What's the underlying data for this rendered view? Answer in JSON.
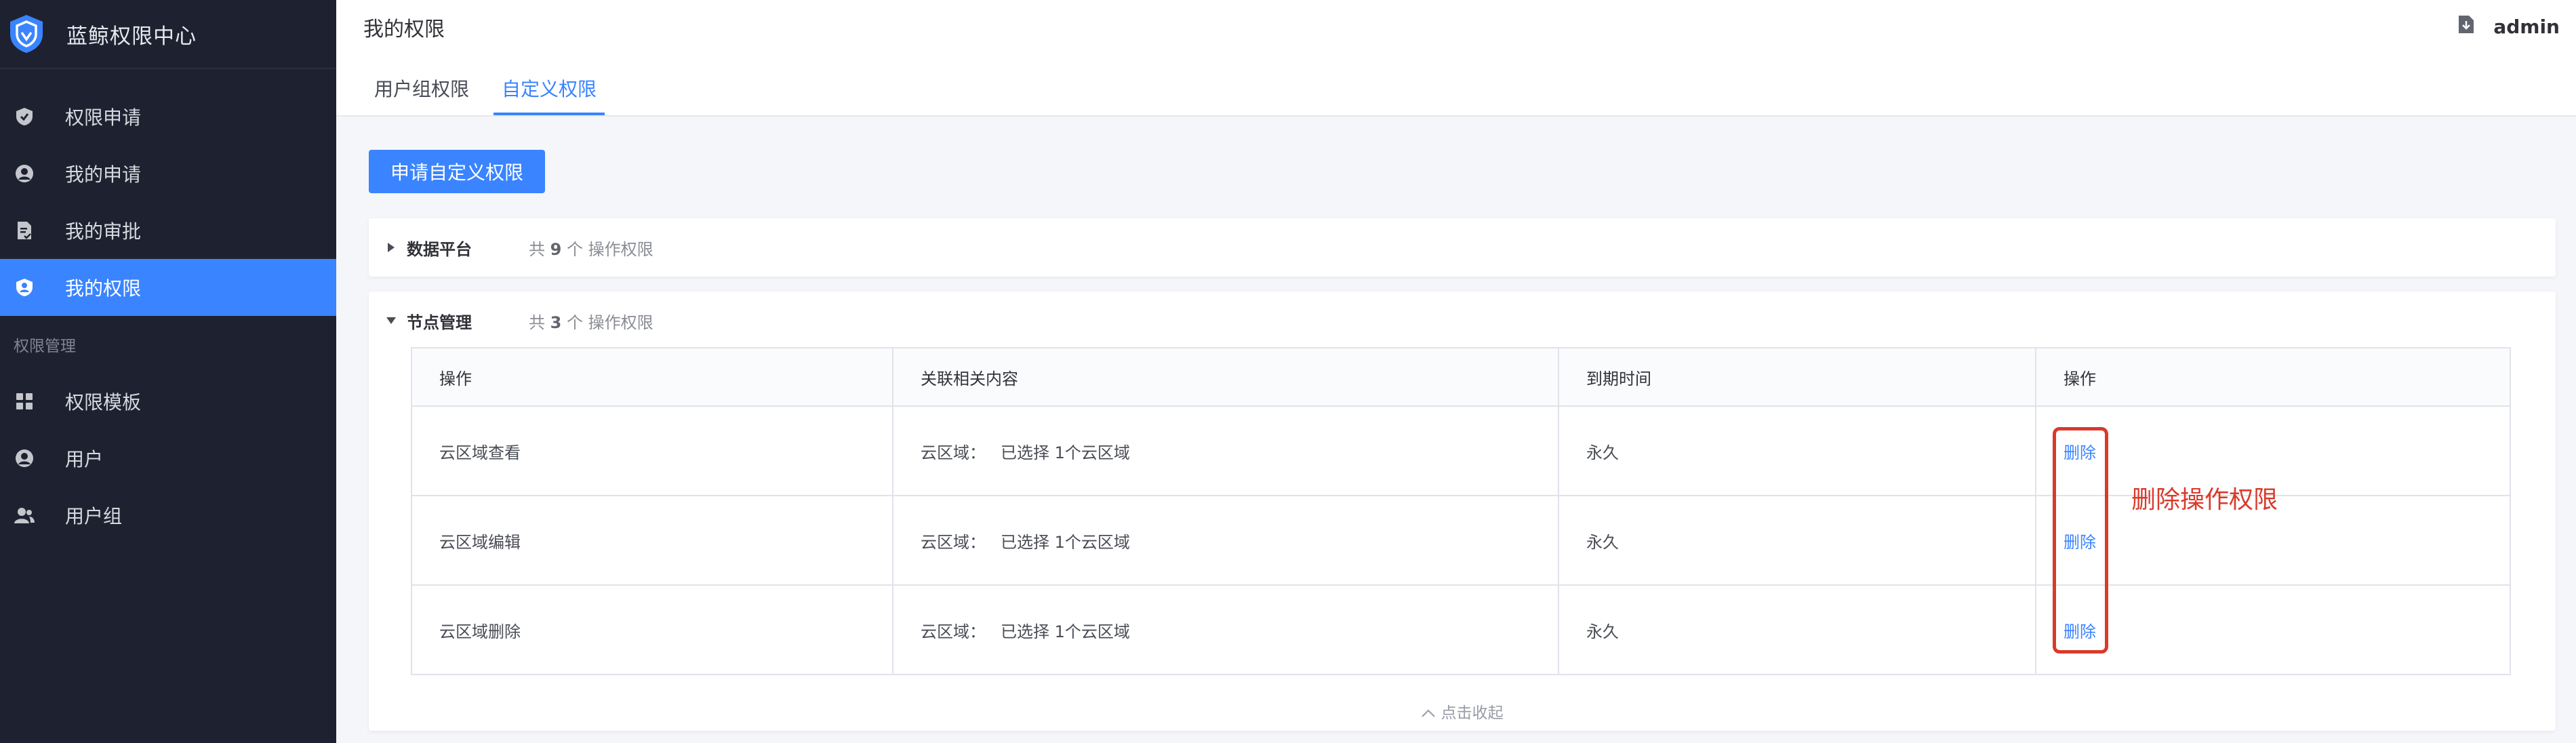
{
  "app": {
    "title": "蓝鲸权限中心",
    "brand_color": "#3a84ff",
    "logo_icon": "shield-logo-icon"
  },
  "sidebar": {
    "items": [
      {
        "label": "权限申请",
        "icon": "shield-check-icon",
        "active": false
      },
      {
        "label": "我的申请",
        "icon": "user-circle-icon",
        "active": false
      },
      {
        "label": "我的审批",
        "icon": "document-check-icon",
        "active": false
      },
      {
        "label": "我的权限",
        "icon": "shield-user-icon",
        "active": true
      }
    ],
    "group_title": "权限管理",
    "group_items": [
      {
        "label": "权限模板",
        "icon": "grid-icon"
      },
      {
        "label": "用户",
        "icon": "user-circle-icon"
      },
      {
        "label": "用户组",
        "icon": "users-icon"
      }
    ]
  },
  "header": {
    "page_title": "我的权限",
    "user": "admin",
    "user_icon": "download-doc-icon",
    "tabs": [
      {
        "label": "用户组权限",
        "active": false
      },
      {
        "label": "自定义权限",
        "active": true
      }
    ]
  },
  "main": {
    "apply_button": "申请自定义权限",
    "panels": [
      {
        "name": "数据平台",
        "count_prefix": "共",
        "count": "9",
        "count_suffix": "个 操作权限",
        "expanded": false
      },
      {
        "name": "节点管理",
        "count_prefix": "共",
        "count": "3",
        "count_suffix": "个 操作权限",
        "expanded": true,
        "table": {
          "headers": [
            "操作",
            "关联相关内容",
            "到期时间",
            "操作"
          ],
          "rows": [
            {
              "action": "云区域查看",
              "related_label": "云区域：",
              "related_value": "已选择 1个云区域",
              "expire": "永久",
              "op": "删除"
            },
            {
              "action": "云区域编辑",
              "related_label": "云区域：",
              "related_value": "已选择 1个云区域",
              "expire": "永久",
              "op": "删除"
            },
            {
              "action": "云区域删除",
              "related_label": "云区域：",
              "related_value": "已选择 1个云区域",
              "expire": "永久",
              "op": "删除"
            }
          ]
        },
        "collapse_label": "点击收起"
      }
    ]
  },
  "annotation": {
    "text": "删除操作权限",
    "color": "#d93a2b"
  }
}
